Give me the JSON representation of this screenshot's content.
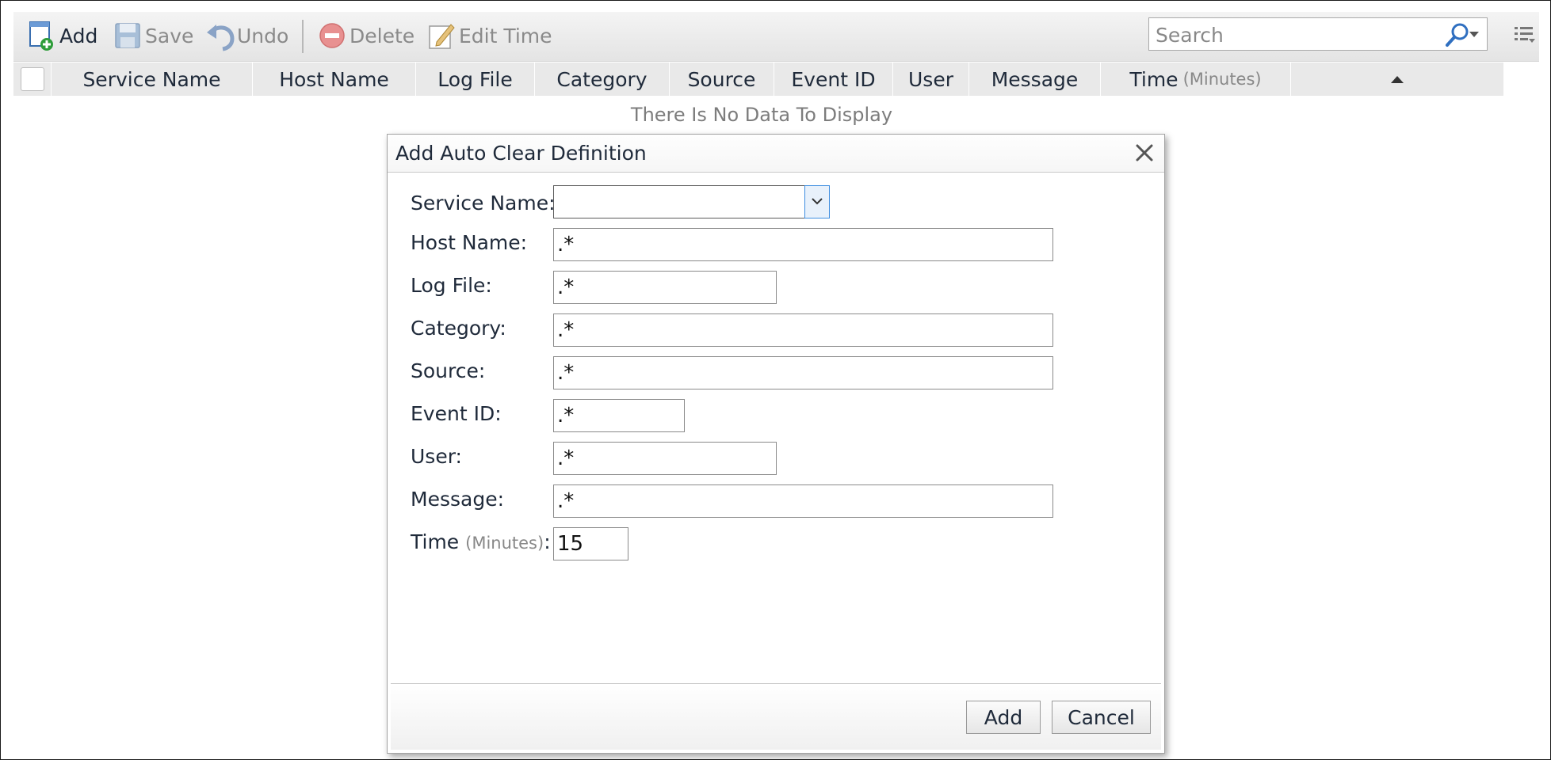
{
  "toolbar": {
    "add_label": "Add",
    "save_label": "Save",
    "undo_label": "Undo",
    "delete_label": "Delete",
    "edit_time_label": "Edit Time",
    "search_placeholder": "Search"
  },
  "grid": {
    "columns": {
      "service_name": "Service Name",
      "host_name": "Host Name",
      "log_file": "Log File",
      "category": "Category",
      "source": "Source",
      "event_id": "Event ID",
      "user": "User",
      "message": "Message",
      "time": "Time",
      "time_unit": "(Minutes)"
    },
    "empty_text": "There Is No Data To Display"
  },
  "dialog": {
    "title": "Add Auto Clear Definition",
    "fields": {
      "service_name": {
        "label": "Service Name:",
        "value": ""
      },
      "host_name": {
        "label": "Host Name:",
        "value": ".*"
      },
      "log_file": {
        "label": "Log File:",
        "value": ".*"
      },
      "category": {
        "label": "Category:",
        "value": ".*"
      },
      "source": {
        "label": "Source:",
        "value": ".*"
      },
      "event_id": {
        "label": "Event ID:",
        "value": ".*"
      },
      "user": {
        "label": "User:",
        "value": ".*"
      },
      "message": {
        "label": "Message:",
        "value": ".*"
      },
      "time": {
        "label": "Time",
        "unit": "(Minutes)",
        "colon": ":",
        "value": "15"
      }
    },
    "add_button": "Add",
    "cancel_button": "Cancel"
  },
  "icons": {
    "add": "add-document-icon",
    "save": "floppy-disk-icon",
    "undo": "undo-arrow-icon",
    "delete": "delete-circle-icon",
    "edit_time": "edit-pencil-icon",
    "search": "magnifier-icon",
    "columns": "column-chooser-icon",
    "close": "close-icon"
  },
  "colors": {
    "accent": "#3f8ee0",
    "add_icon_green": "#2e9d3a",
    "delete_red": "#e07070"
  }
}
